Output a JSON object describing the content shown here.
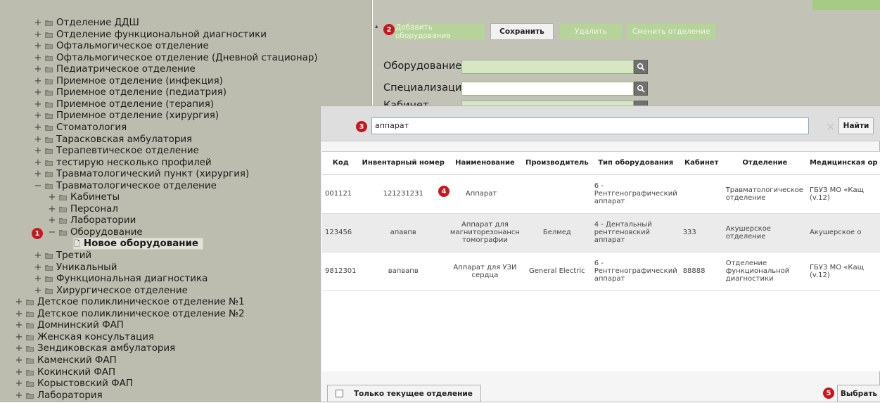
{
  "tree": {
    "items": [
      {
        "label": "Отделение ДДШ",
        "toggle": "+",
        "level": 1
      },
      {
        "label": "Отделение функциональной диагностики",
        "toggle": "+",
        "level": 1
      },
      {
        "label": "Офтальмогическое отделение",
        "toggle": "+",
        "level": 1
      },
      {
        "label": "Офтальмогическое отделение (Дневной стационар)",
        "toggle": "+",
        "level": 1
      },
      {
        "label": "Педиатрическое отделение",
        "toggle": "+",
        "level": 1
      },
      {
        "label": "Приемное отделение (инфекция)",
        "toggle": "+",
        "level": 1
      },
      {
        "label": "Приемное отделение (педиатрия)",
        "toggle": "+",
        "level": 1
      },
      {
        "label": "Приемное отделение (терапия)",
        "toggle": "+",
        "level": 1
      },
      {
        "label": "Приемное отделение (хирургия)",
        "toggle": "+",
        "level": 1
      },
      {
        "label": "Стоматология",
        "toggle": "+",
        "level": 1
      },
      {
        "label": "Тарасковская амбулатория",
        "toggle": "+",
        "level": 1
      },
      {
        "label": "Терапевтическое отделение",
        "toggle": "+",
        "level": 1
      },
      {
        "label": "тестирую несколько профилей",
        "toggle": "+",
        "level": 1
      },
      {
        "label": "Травматологический пункт (хирургия)",
        "toggle": "+",
        "level": 1
      },
      {
        "label": "Травматологическое отделение",
        "toggle": "−",
        "level": 1
      },
      {
        "label": "Кабинеты",
        "toggle": "+",
        "level": 2
      },
      {
        "label": "Персонал",
        "toggle": "+",
        "level": 2
      },
      {
        "label": "Лаборатории",
        "toggle": "+",
        "level": 2
      },
      {
        "label": "Оборудование",
        "toggle": "−",
        "level": 2
      },
      {
        "label": "Новое оборудование",
        "toggle": "",
        "level": 3
      },
      {
        "label": "Третий",
        "toggle": "+",
        "level": 1
      },
      {
        "label": "Уникальный",
        "toggle": "+",
        "level": 1
      },
      {
        "label": "Функциональная диагностика",
        "toggle": "+",
        "level": 1
      },
      {
        "label": "Хирургическое отделение",
        "toggle": "+",
        "level": 1
      },
      {
        "label": "Детское поликлиническое отделение №1",
        "toggle": "+",
        "level": 0
      },
      {
        "label": "Детское поликлиническое отделение №2",
        "toggle": "+",
        "level": 0
      },
      {
        "label": "Домнинский ФАП",
        "toggle": "+",
        "level": 0
      },
      {
        "label": "Женская консультация",
        "toggle": "+",
        "level": 0
      },
      {
        "label": "Зендиковская амбулатория",
        "toggle": "+",
        "level": 0
      },
      {
        "label": "Каменский ФАП",
        "toggle": "+",
        "level": 0
      },
      {
        "label": "Кокинский ФАП",
        "toggle": "+",
        "level": 0
      },
      {
        "label": "Корыстовский ФАП",
        "toggle": "+",
        "level": 0
      },
      {
        "label": "Лаборатория",
        "toggle": "+",
        "level": 0
      }
    ]
  },
  "toolbar": {
    "add_label": "Добавить оборудование",
    "save_label": "Сохранить",
    "delete_label": "Удалить",
    "change_dept_label": "Сменить отделение"
  },
  "form": {
    "equipment_label": "Оборудование",
    "specialization_label": "Специализация",
    "cabinet_label": "Кабинет"
  },
  "markers": [
    "1",
    "2",
    "3",
    "4",
    "5"
  ],
  "dialog": {
    "search_value": "аппарат",
    "find_label": "Найти",
    "columns": [
      "Код",
      "Инвентарный номер",
      "Наименование",
      "Производитель",
      "Тип оборудования",
      "Кабинет",
      "Отделение",
      "Медицинская ор"
    ],
    "rows": [
      {
        "code": "001121",
        "inv": "121231231",
        "name": "Аппарат",
        "maker": "",
        "type": "6 - Рентгенографический аппарат",
        "cabinet": "",
        "dept": "Травматологическое отделение",
        "org": "ГБУЗ МО «Кащ (v.12)"
      },
      {
        "code": "123456",
        "inv": "апавпв",
        "name": "Аппарат для магниторезонансн томографии",
        "maker": "Белмед",
        "type": "4 - Дентальный рентгеновский аппарат",
        "cabinet": "333",
        "dept": "Акушерское отделение",
        "org": "Акушерское о"
      },
      {
        "code": "9812301",
        "inv": "вапвапв",
        "name": "Аппарат для УЗИ сердца",
        "maker": "General Electric",
        "type": "6 - Рентгенографический аппарат",
        "cabinet": "88888",
        "dept": "Отделение функциональной диагностики",
        "org": "ГБУЗ МО «Кащ (v.12)"
      }
    ],
    "only_current_label": "Только текущее отделение",
    "select_label": "Выбрать"
  },
  "colors": {
    "tree_bg": "#bdbdaf",
    "form_bg": "#c2c2b6",
    "green_button": "#b7d39b",
    "marker_red": "#c8161d",
    "input_green": "#d8e6c6"
  }
}
